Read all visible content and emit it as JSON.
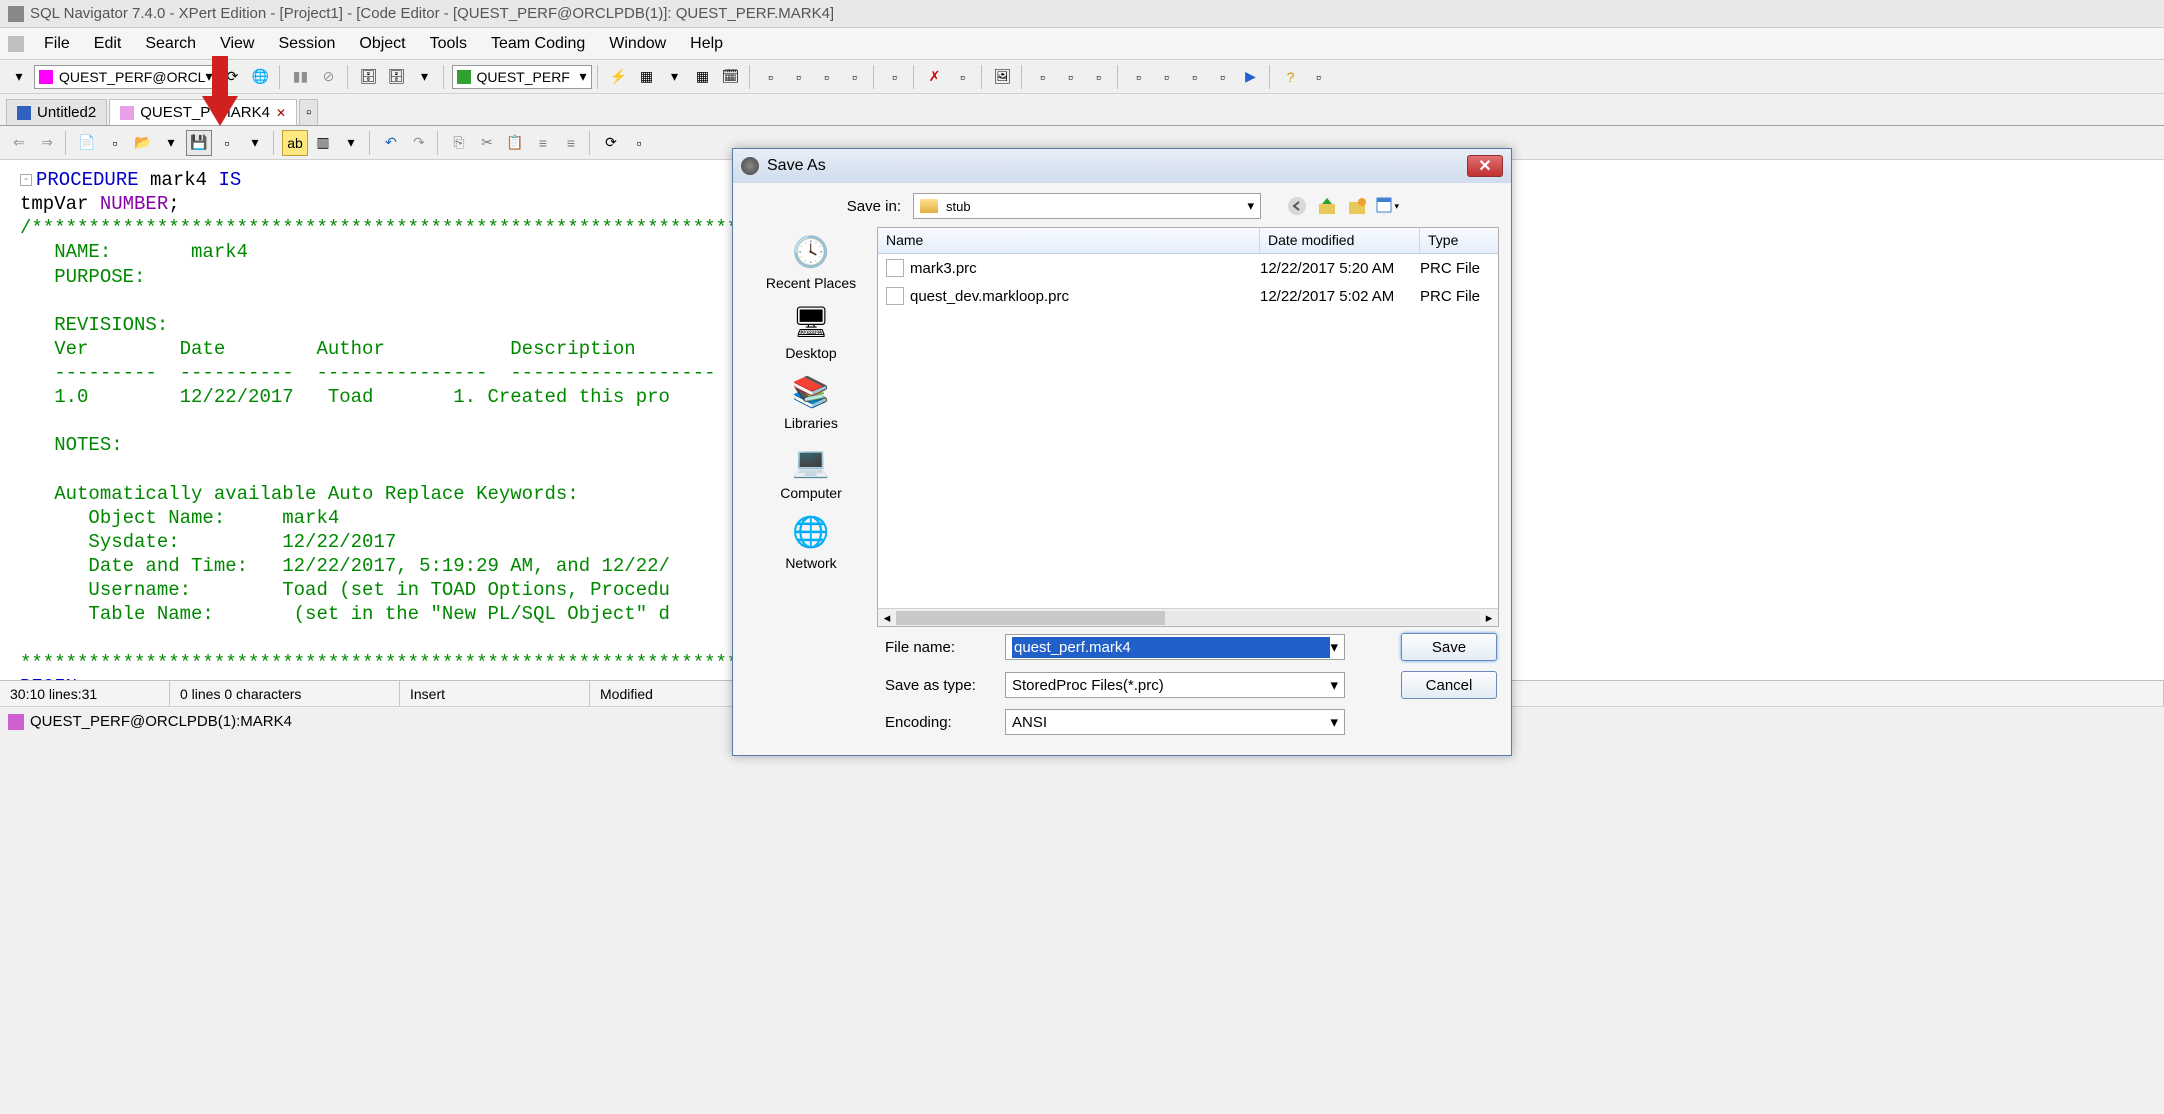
{
  "titlebar": {
    "text": "SQL Navigator 7.4.0 - XPert Edition - [Project1] - [Code Editor - [QUEST_PERF@ORCLPDB(1)]: QUEST_PERF.MARK4]"
  },
  "menubar": {
    "items": [
      "File",
      "Edit",
      "Search",
      "View",
      "Session",
      "Object",
      "Tools",
      "Team Coding",
      "Window",
      "Help"
    ]
  },
  "toolbar1": {
    "connection_combo": "QUEST_PERF@ORCL",
    "session_combo": "QUEST_PERF"
  },
  "tabs": [
    {
      "label": "Untitled2",
      "kind": "sql",
      "closable": false
    },
    {
      "label": "QUEST_P       .MARK4",
      "kind": "po",
      "closable": true
    }
  ],
  "code": {
    "l1a": "PROCEDURE",
    "l1b": " mark4 ",
    "l1c": "IS",
    "l2a": "tmpVar ",
    "l2b": "NUMBER",
    "l2c": ";",
    "l3": "/******************************************************************",
    "l4": "   NAME:       mark4",
    "l5": "   PURPOSE:",
    "l6": "",
    "l7": "   REVISIONS:",
    "l8": "   Ver        Date        Author           Description",
    "l9": "   ---------  ----------  ---------------  ------------------",
    "l10": "   1.0        12/22/2017   Toad       1. Created this pro",
    "l11": "",
    "l12": "   NOTES:",
    "l13": "",
    "l14": "   Automatically available Auto Replace Keywords:",
    "l15": "      Object Name:     mark4",
    "l16": "      Sysdate:         12/22/2017",
    "l17": "      Date and Time:   12/22/2017, 5:19:29 AM, and 12/22/",
    "l18": "      Username:        Toad (set in TOAD Options, Procedu",
    "l19": "      Table Name:       (set in the \"New PL/SQL Object\" d",
    "l20": "",
    "l21": "******************************************************************",
    "l22": "BEGIN"
  },
  "statusbar": {
    "pos": "30:10 lines:31",
    "sel": "0 lines 0 characters",
    "mode": "Insert",
    "state": "Modified"
  },
  "bottom": {
    "conn": "QUEST_PERF@ORCLPDB(1):MARK4"
  },
  "saveas": {
    "title": "Save As",
    "savein_label": "Save in:",
    "savein_value": "stub",
    "places": [
      "Recent Places",
      "Desktop",
      "Libraries",
      "Computer",
      "Network"
    ],
    "headers": {
      "name": "Name",
      "date": "Date modified",
      "type": "Type"
    },
    "files": [
      {
        "name": "mark3.prc",
        "date": "12/22/2017 5:20 AM",
        "type": "PRC File"
      },
      {
        "name": "quest_dev.markloop.prc",
        "date": "12/22/2017 5:02 AM",
        "type": "PRC File"
      }
    ],
    "filename_label": "File name:",
    "filename_value": "quest_perf.mark4",
    "savetype_label": "Save as type:",
    "savetype_value": "StoredProc Files(*.prc)",
    "encoding_label": "Encoding:",
    "encoding_value": "ANSI",
    "save_btn": "Save",
    "cancel_btn": "Cancel"
  }
}
